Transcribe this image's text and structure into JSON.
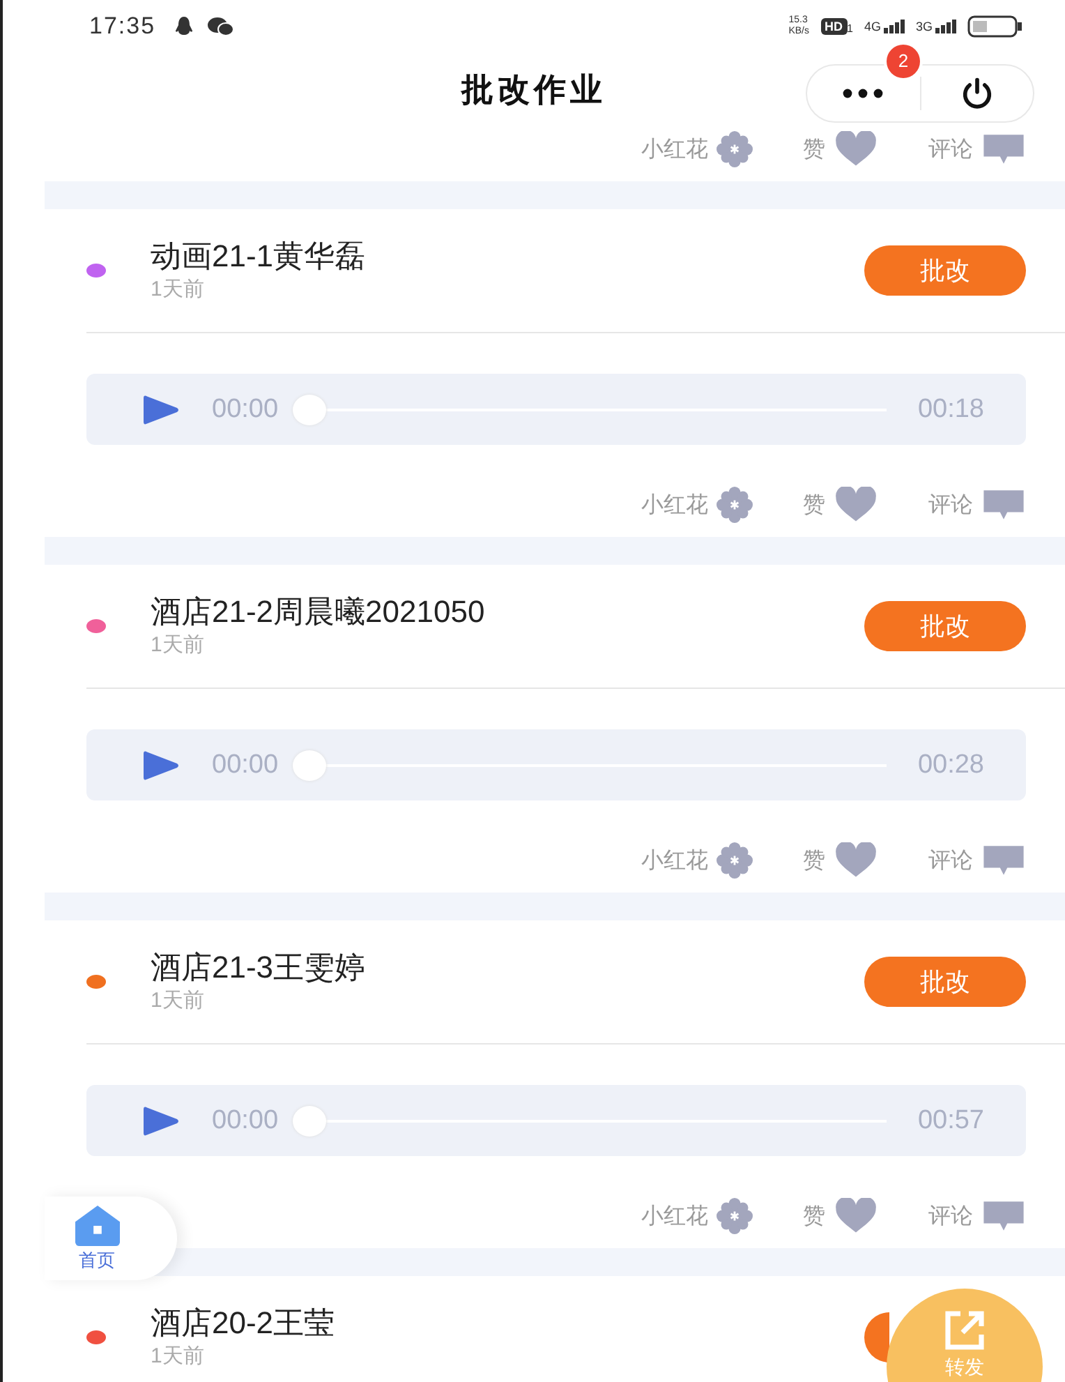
{
  "status_bar": {
    "time": "17:35",
    "speed_value": "15.3",
    "speed_unit": "KB/s",
    "hd": "HD",
    "hd_index": "1",
    "sim1": "4G",
    "sim2": "3G"
  },
  "header": {
    "title": "批改作业",
    "badge": "2"
  },
  "top_actions": [
    "小红花",
    "赞",
    "评论"
  ],
  "posts": [
    {
      "kind": "full",
      "name": "动画21-1黄华磊",
      "time": "1天前",
      "color": "#c063f0",
      "button": "批改",
      "audio": {
        "current": "00:00",
        "duration": "00:18",
        "level": 0
      },
      "actions": [
        "小红花",
        "赞",
        "评论"
      ]
    },
    {
      "kind": "full",
      "name": "酒店21-2周晨曦2021050",
      "time": "1天前",
      "color": "#f0609a",
      "button": "批改",
      "audio": {
        "current": "00:00",
        "duration": "00:28",
        "level": 0
      },
      "actions": [
        "小红花",
        "赞",
        "评论"
      ]
    },
    {
      "kind": "full",
      "name": "酒店21-3王雯婷",
      "time": "1天前",
      "color": "#f07020",
      "button": "批改",
      "audio": {
        "current": "00:00",
        "duration": "00:57",
        "level": 0
      },
      "actions": [
        "小红花",
        "赞",
        "评论"
      ]
    },
    {
      "kind": "partial",
      "name": "酒店20-2王莹",
      "time": "1天前",
      "color": "#f05040"
    }
  ],
  "floating": {
    "home": "首页",
    "share": "转发"
  }
}
